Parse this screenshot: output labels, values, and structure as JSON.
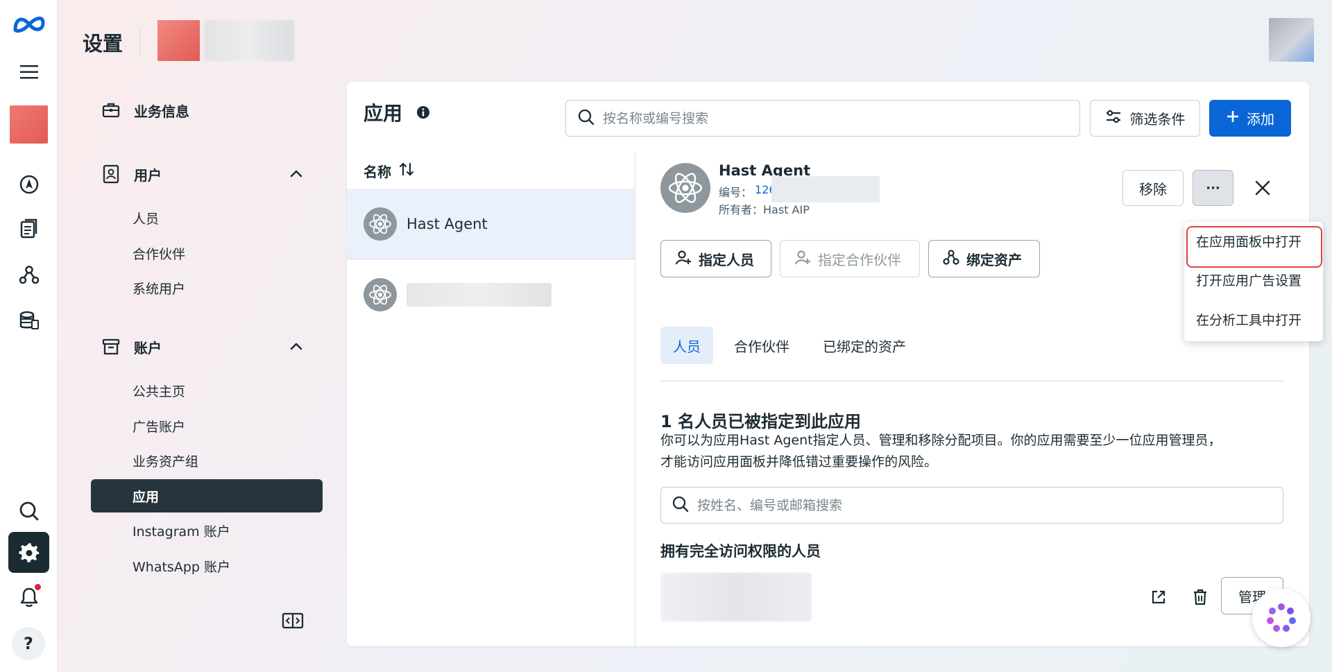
{
  "header": {
    "title": "设置"
  },
  "sidebar": {
    "business_info": "业务信息",
    "users": {
      "label": "用户",
      "items": [
        "人员",
        "合作伙伴",
        "系统用户"
      ]
    },
    "accounts": {
      "label": "账户",
      "items": [
        "公共主页",
        "广告账户",
        "业务资产组",
        "应用",
        "Instagram 账户",
        "WhatsApp 账户"
      ]
    }
  },
  "main": {
    "title": "应用",
    "search_placeholder": "按名称或编号搜索",
    "filter_label": "筛选条件",
    "add_label": "添加",
    "list_header": "名称",
    "apps": [
      {
        "name": "Hast Agent",
        "selected": true
      },
      {
        "name": "",
        "selected": false
      }
    ]
  },
  "detail": {
    "name": "Hast Agent",
    "id_label": "编号：",
    "id_value": "126",
    "owner_label": "所有者：",
    "owner_value": "Hast AIP",
    "remove_label": "移除",
    "more_label": "···",
    "actions": {
      "assign_people": "指定人员",
      "assign_partner": "指定合作伙伴",
      "bind_assets": "绑定资产"
    },
    "tabs": [
      "人员",
      "合作伙伴",
      "已绑定的资产"
    ],
    "section_title": "1 名人员已被指定到此应用",
    "section_desc_1": "你可以为应用Hast Agent指定人员、管理和移除分配项目。你的应用需要至少一位应用管理员，",
    "section_desc_2": "才能访问应用面板并降低错过重要操作的风险。",
    "people_search_placeholder": "按姓名、编号或邮箱搜索",
    "full_access_title": "拥有完全访问权限的人员",
    "manage_label": "管理"
  },
  "menu": {
    "items": [
      "在应用面板中打开",
      "打开应用广告设置",
      "在分析工具中打开"
    ]
  },
  "colors": {
    "accent": "#0a66d6",
    "active_nav": "#27343d",
    "highlight": "#e0403d"
  }
}
